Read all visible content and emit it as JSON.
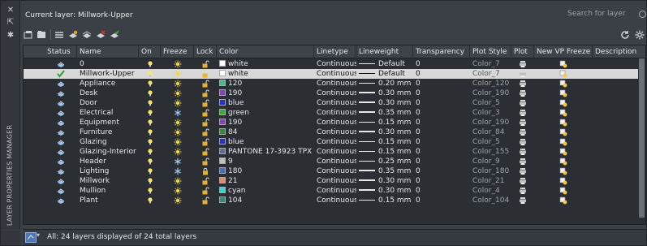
{
  "panel": {
    "vertical_title": "LAYER PROPERTIES MANAGER",
    "current_layer_label": "Current layer: Millwork-Upper",
    "search_placeholder": "Search for layer",
    "status_text": "All: 24 layers displayed of 24 total layers"
  },
  "columns": [
    "Status",
    "Name",
    "On",
    "Freeze",
    "Lock",
    "Color",
    "Linetype",
    "Lineweight",
    "Transparency",
    "Plot Style",
    "Plot",
    "New VP Freeze",
    "Description"
  ],
  "icons": {
    "window_controls": [
      "close-icon",
      "pin-icon",
      "settings-icon"
    ],
    "toolbar": [
      "new-property-filter-icon",
      "new-group-filter-icon",
      "layer-states-manager-icon",
      "new-layer-icon",
      "new-layer-vp-frozen-icon",
      "delete-layer-icon",
      "set-current-icon"
    ],
    "right": [
      "refresh-icon",
      "settings-icon"
    ]
  },
  "layers": [
    {
      "name": "0",
      "status": "layer",
      "on": true,
      "freeze": "thawed",
      "lock": "unlocked",
      "color_name": "white",
      "color": "#ffffff",
      "linetype": "Continuous",
      "lineweight": "Default",
      "lw_style": "thin",
      "transparency": "0",
      "plot_style": "Color_7",
      "plot": "plot-icon",
      "vp": "vp-freeze-icon",
      "selected": false
    },
    {
      "name": "Millwork-Upper",
      "status": "current",
      "on": true,
      "freeze": "thawed",
      "lock": "unlocked",
      "color_name": "white",
      "color": "#ffffff",
      "linetype": "Continuous",
      "lineweight": "Default",
      "lw_style": "thin",
      "transparency": "0",
      "plot_style": "Color_7",
      "plot": "plot-icon",
      "vp": "vp-freeze-icon",
      "selected": true
    },
    {
      "name": "Appliance",
      "status": "layer",
      "on": true,
      "freeze": "thawed",
      "lock": "unlocked",
      "color_name": "120",
      "color": "#3fbf8c",
      "linetype": "Continuous",
      "lineweight": "0.20 mm",
      "lw_style": "thin",
      "transparency": "0",
      "plot_style": "Color_120",
      "plot": "plot-icon",
      "vp": "vp-freeze-icon",
      "selected": false
    },
    {
      "name": "Desk",
      "status": "layer",
      "on": true,
      "freeze": "thawed",
      "lock": "unlocked",
      "color_name": "190",
      "color": "#8a3fbf",
      "linetype": "Continuous",
      "lineweight": "0.30 mm",
      "lw_style": "thick",
      "transparency": "0",
      "plot_style": "Color_190",
      "plot": "plot-icon",
      "vp": "vp-freeze-icon",
      "selected": false
    },
    {
      "name": "Door",
      "status": "layer",
      "on": true,
      "freeze": "thawed",
      "lock": "unlocked",
      "color_name": "blue",
      "color": "#2b2bd9",
      "linetype": "Continuous",
      "lineweight": "0.30 mm",
      "lw_style": "thick",
      "transparency": "0",
      "plot_style": "Color_5",
      "plot": "plot-icon",
      "vp": "vp-freeze-icon",
      "selected": false
    },
    {
      "name": "Electrical",
      "status": "layer",
      "on": true,
      "freeze": "frozen",
      "lock": "unlocked",
      "color_name": "green",
      "color": "#2bb52b",
      "linetype": "Continuous",
      "lineweight": "0.35 mm",
      "lw_style": "thick",
      "transparency": "0",
      "plot_style": "Color_3",
      "plot": "plot-icon",
      "vp": "vp-freeze-icon",
      "selected": false
    },
    {
      "name": "Equipment",
      "status": "layer",
      "on": true,
      "freeze": "thawed",
      "lock": "unlocked",
      "color_name": "190",
      "color": "#8a3fbf",
      "linetype": "Continuous",
      "lineweight": "0.15 mm",
      "lw_style": "thin",
      "transparency": "0",
      "plot_style": "Color_190",
      "plot": "plot-icon",
      "vp": "vp-freeze-icon",
      "selected": false
    },
    {
      "name": "Furniture",
      "status": "layer",
      "on": true,
      "freeze": "thawed",
      "lock": "unlocked",
      "color_name": "84",
      "color": "#2f8a3a",
      "linetype": "Continuous",
      "lineweight": "0.30 mm",
      "lw_style": "thick",
      "transparency": "0",
      "plot_style": "Color_84",
      "plot": "plot-icon",
      "vp": "vp-freeze-icon",
      "selected": false
    },
    {
      "name": "Glazing",
      "status": "layer",
      "on": true,
      "freeze": "thawed",
      "lock": "unlocked",
      "color_name": "blue",
      "color": "#2b2bd9",
      "linetype": "Continuous",
      "lineweight": "0.15 mm",
      "lw_style": "thin",
      "transparency": "0",
      "plot_style": "Color_5",
      "plot": "plot-icon",
      "vp": "vp-freeze-icon",
      "selected": false
    },
    {
      "name": "Glazing-Interior",
      "status": "layer",
      "on": true,
      "freeze": "thawed",
      "lock": "unlocked",
      "color_name": "PANTONE 17-3923 TPX",
      "color": "#5b6e99",
      "linetype": "Continuous",
      "lineweight": "0.15 mm",
      "lw_style": "thin",
      "transparency": "0",
      "plot_style": "Color_155",
      "plot": "plot-icon",
      "vp": "vp-freeze-icon",
      "selected": false
    },
    {
      "name": "Header",
      "status": "layer",
      "on": true,
      "freeze": "frozen",
      "lock": "unlocked",
      "color_name": "9",
      "color": "#c0c0c0",
      "linetype": "Continuous",
      "lineweight": "0.25 mm",
      "lw_style": "thin",
      "transparency": "0",
      "plot_style": "Color_9",
      "plot": "plot-icon",
      "vp": "vp-freeze-icon",
      "selected": false
    },
    {
      "name": "Lighting",
      "status": "layer",
      "on": true,
      "freeze": "frozen",
      "lock": "locked",
      "color_name": "180",
      "color": "#3f6fbf",
      "linetype": "Continuous",
      "lineweight": "0.35 mm",
      "lw_style": "thick",
      "transparency": "0",
      "plot_style": "Color_180",
      "plot": "plot-icon",
      "vp": "vp-freeze-icon",
      "selected": false
    },
    {
      "name": "Millwork",
      "status": "layer",
      "on": true,
      "freeze": "thawed",
      "lock": "unlocked",
      "color_name": "21",
      "color": "#e88a6a",
      "linetype": "Continuous",
      "lineweight": "0.30 mm",
      "lw_style": "thick",
      "transparency": "0",
      "plot_style": "Color_21",
      "plot": "plot-icon",
      "vp": "vp-freeze-icon",
      "selected": false
    },
    {
      "name": "Mullion",
      "status": "layer",
      "on": true,
      "freeze": "thawed",
      "lock": "unlocked",
      "color_name": "cyan",
      "color": "#2bd9d9",
      "linetype": "Continuous",
      "lineweight": "0.30 mm",
      "lw_style": "thick",
      "transparency": "0",
      "plot_style": "Color_4",
      "plot": "plot-icon",
      "vp": "vp-freeze-icon",
      "selected": false
    },
    {
      "name": "Plant",
      "status": "layer",
      "on": true,
      "freeze": "thawed",
      "lock": "unlocked",
      "color_name": "104",
      "color": "#2f8a6e",
      "linetype": "Continuous",
      "lineweight": "0.15 mm",
      "lw_style": "thin",
      "transparency": "0",
      "plot_style": "Color_104",
      "plot": "plot-icon",
      "vp": "vp-freeze-icon",
      "selected": false
    }
  ]
}
